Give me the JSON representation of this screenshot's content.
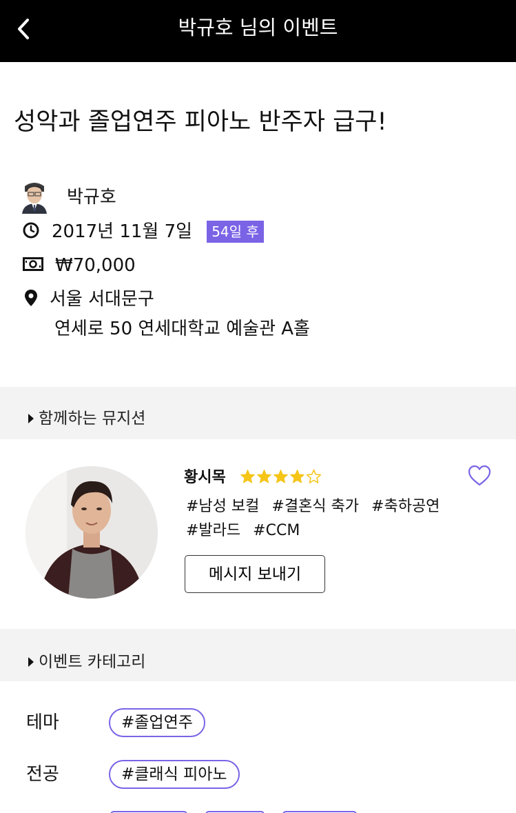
{
  "header": {
    "title": "박규호 님의 이벤트",
    "back_icon": "chevron-left-icon"
  },
  "event": {
    "title": "성악과 졸업연주 피아노 반주자 급구!",
    "host_name": "박규호",
    "date": "2017년 11월 7일",
    "d_day": "54일 후",
    "price": "₩70,000",
    "location_line1": "서울 서대문구",
    "location_line2": "연세로 50 연세대학교 예술관 A홀"
  },
  "musicians_section": {
    "title": "함께하는 뮤지션",
    "musician": {
      "name": "황시목",
      "rating": 4,
      "rating_max": 5,
      "tags_line1": [
        "#남성 보컬",
        "#결혼식 축가",
        "#축하공연"
      ],
      "tags_line2": [
        "#발라드",
        "#CCM"
      ],
      "message_button": "메시지 보내기"
    }
  },
  "category_section": {
    "title": "이벤트 카테고리",
    "rows": [
      {
        "label": "테마",
        "chip": "#졸업연주"
      },
      {
        "label": "전공",
        "chip": "#클래식 피아노"
      }
    ]
  },
  "colors": {
    "accent": "#7b63e6",
    "star": "#f5c518",
    "header_bg": "#000000",
    "section_bg": "#f3f3f3"
  }
}
